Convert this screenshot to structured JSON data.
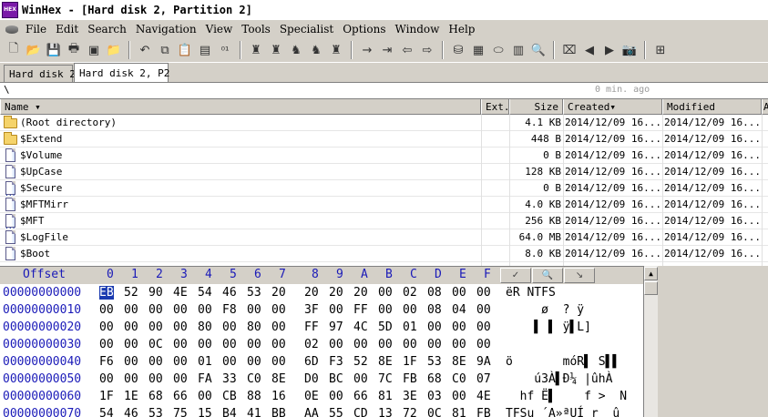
{
  "window": {
    "title": "WinHex - [Hard disk 2, Partition 2]",
    "icon_label": "HEX"
  },
  "menu": [
    "File",
    "Edit",
    "Search",
    "Navigation",
    "View",
    "Tools",
    "Specialist",
    "Options",
    "Window",
    "Help"
  ],
  "toolbar_icons": [
    "new-file-icon",
    "open-file-icon",
    "save-icon",
    "print-icon",
    "properties-icon",
    "open-folder-icon",
    "undo-icon",
    "copy-icon",
    "paste-icon",
    "paste-special-icon",
    "binary-icon",
    "find-text-icon",
    "find-hex-icon",
    "replace-text-icon",
    "replace-hex-icon",
    "find-integer-icon",
    "goto-offset-icon",
    "goto-sector-icon",
    "back-icon",
    "forward-icon",
    "disk-open-icon",
    "ram-editor-icon",
    "disk-tools-icon",
    "calculator-icon",
    "search-icon",
    "clone-icon",
    "prev-icon",
    "next-icon",
    "snapshot-icon",
    "options-icon"
  ],
  "tabs": [
    {
      "label": "Hard disk 2",
      "active": false
    },
    {
      "label": "Hard disk 2, P2",
      "active": true
    }
  ],
  "path": {
    "text": "\\",
    "status": "0 min. ago"
  },
  "file_list": {
    "headers": {
      "name": "Name",
      "ext": "Ext.",
      "size": "Size",
      "created": "Created",
      "modified": "Modified",
      "extra": "A"
    },
    "rows": [
      {
        "name": "(Root directory)",
        "ext": "",
        "size": "4.1 KB",
        "created": "2014/12/09  16...",
        "modified": "2014/12/09  16...",
        "icon": "folder"
      },
      {
        "name": "$Extend",
        "ext": "",
        "size": "448 B",
        "created": "2014/12/09  16...",
        "modified": "2014/12/09  16...",
        "icon": "folder"
      },
      {
        "name": "$Volume",
        "ext": "",
        "size": "0 B",
        "created": "2014/12/09  16...",
        "modified": "2014/12/09  16...",
        "icon": "file"
      },
      {
        "name": "$UpCase",
        "ext": "",
        "size": "128 KB",
        "created": "2014/12/09  16...",
        "modified": "2014/12/09  16...",
        "icon": "file"
      },
      {
        "name": "$Secure",
        "ext": "",
        "size": "0 B",
        "created": "2014/12/09  16...",
        "modified": "2014/12/09  16...",
        "icon": "file-dots"
      },
      {
        "name": "$MFTMirr",
        "ext": "",
        "size": "4.0 KB",
        "created": "2014/12/09  16...",
        "modified": "2014/12/09  16...",
        "icon": "file"
      },
      {
        "name": "$MFT",
        "ext": "",
        "size": "256 KB",
        "created": "2014/12/09  16...",
        "modified": "2014/12/09  16...",
        "icon": "file-dots"
      },
      {
        "name": "$LogFile",
        "ext": "",
        "size": "64.0 MB",
        "created": "2014/12/09  16...",
        "modified": "2014/12/09  16...",
        "icon": "file"
      },
      {
        "name": "$Boot",
        "ext": "",
        "size": "8.0 KB",
        "created": "2014/12/09  16...",
        "modified": "2014/12/09  16...",
        "icon": "file"
      }
    ]
  },
  "hex": {
    "offset_label": "Offset",
    "columns": [
      "0",
      "1",
      "2",
      "3",
      "4",
      "5",
      "6",
      "7",
      "8",
      "9",
      "A",
      "B",
      "C",
      "D",
      "E",
      "F"
    ],
    "rows": [
      {
        "offset": "00000000000",
        "bytes": [
          "EB",
          "52",
          "90",
          "4E",
          "54",
          "46",
          "53",
          "20",
          "20",
          "20",
          "20",
          "00",
          "02",
          "08",
          "00",
          "00"
        ],
        "text": "ëR NTFS"
      },
      {
        "offset": "00000000010",
        "bytes": [
          "00",
          "00",
          "00",
          "00",
          "00",
          "F8",
          "00",
          "00",
          "3F",
          "00",
          "FF",
          "00",
          "00",
          "08",
          "04",
          "00"
        ],
        "text": "     ø  ? ÿ"
      },
      {
        "offset": "00000000020",
        "bytes": [
          "00",
          "00",
          "00",
          "00",
          "80",
          "00",
          "80",
          "00",
          "FF",
          "97",
          "4C",
          "5D",
          "01",
          "00",
          "00",
          "00"
        ],
        "text": "    ▌ ▌ ÿ▌L]"
      },
      {
        "offset": "00000000030",
        "bytes": [
          "00",
          "00",
          "0C",
          "00",
          "00",
          "00",
          "00",
          "00",
          "02",
          "00",
          "00",
          "00",
          "00",
          "00",
          "00",
          "00"
        ],
        "text": ""
      },
      {
        "offset": "00000000040",
        "bytes": [
          "F6",
          "00",
          "00",
          "00",
          "01",
          "00",
          "00",
          "00",
          "6D",
          "F3",
          "52",
          "8E",
          "1F",
          "53",
          "8E",
          "9A"
        ],
        "text": "ö       móR▌ S▌▌"
      },
      {
        "offset": "00000000050",
        "bytes": [
          "00",
          "00",
          "00",
          "00",
          "FA",
          "33",
          "C0",
          "8E",
          "D0",
          "BC",
          "00",
          "7C",
          "FB",
          "68",
          "C0",
          "07"
        ],
        "text": "    ú3À▌Ð¼ |ûhÀ"
      },
      {
        "offset": "00000000060",
        "bytes": [
          "1F",
          "1E",
          "68",
          "66",
          "00",
          "CB",
          "88",
          "16",
          "0E",
          "00",
          "66",
          "81",
          "3E",
          "03",
          "00",
          "4E"
        ],
        "text": "  hf Ë▌    f >  N"
      },
      {
        "offset": "00000000070",
        "bytes": [
          "54",
          "46",
          "53",
          "75",
          "15",
          "B4",
          "41",
          "BB",
          "AA",
          "55",
          "CD",
          "13",
          "72",
          "0C",
          "81",
          "FB"
        ],
        "text": "TFSu ´A»ªUÍ r  û"
      }
    ],
    "panel_buttons": [
      "checkmark-icon",
      "find-icon",
      "arrow-icon"
    ]
  }
}
